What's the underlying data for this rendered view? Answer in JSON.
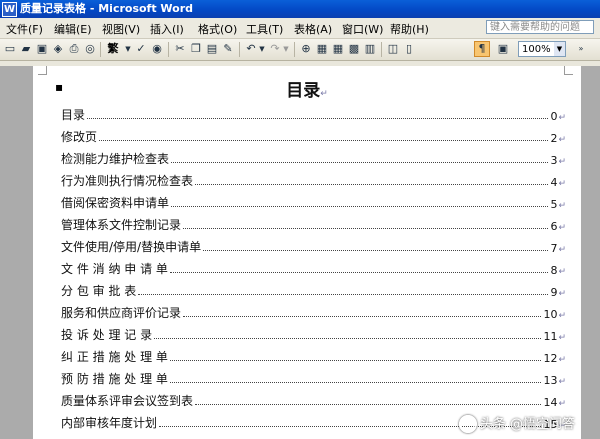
{
  "window": {
    "title": "质量记录表格 - Microsoft Word"
  },
  "menu": {
    "items": [
      "文件(F)",
      "编辑(E)",
      "视图(V)",
      "插入(I)",
      "格式(O)",
      "工具(T)",
      "表格(A)",
      "窗口(W)",
      "帮助(H)"
    ],
    "help_placeholder": "键入需要帮助的问题"
  },
  "toolbar": {
    "zoom": "100%",
    "font_style": "繁",
    "icons": [
      "new-doc-icon",
      "open-icon",
      "save-icon",
      "permission-icon",
      "print-icon",
      "print-preview-icon",
      "traditional-chinese-icon",
      "spelling-icon",
      "research-icon",
      "cut-icon",
      "copy-icon",
      "paste-icon",
      "format-painter-icon",
      "undo-icon",
      "redo-icon",
      "hyperlink-icon",
      "tables-borders-icon",
      "insert-table-icon",
      "insert-excel-icon",
      "columns-icon",
      "drawing-icon",
      "document-map-icon",
      "show-hide-icon",
      "read-icon"
    ]
  },
  "document": {
    "title": "目录",
    "toc": [
      {
        "label": "目录",
        "page": "0"
      },
      {
        "label": "修改页",
        "page": "2"
      },
      {
        "label": "检测能力维护检查表",
        "page": "3"
      },
      {
        "label": "行为准则执行情况检查表",
        "page": "4"
      },
      {
        "label": "借阅保密资料申请单",
        "page": "5"
      },
      {
        "label": "管理体系文件控制记录",
        "page": "6"
      },
      {
        "label": "文件使用/停用/替换申请单",
        "page": "7"
      },
      {
        "label": "文 件 消 纳 申 请 单",
        "page": "8"
      },
      {
        "label": "分  包  审  批  表",
        "page": "9"
      },
      {
        "label": "服务和供应商评价记录",
        "page": "10"
      },
      {
        "label": "投  诉  处  理  记  录",
        "page": "11"
      },
      {
        "label": "纠 正 措 施 处 理 单",
        "page": "12"
      },
      {
        "label": "预 防 措 施 处 理 单",
        "page": "13"
      },
      {
        "label": "质量体系评审会议签到表",
        "page": "14"
      },
      {
        "label": "内部审核年度计划",
        "page": "15"
      }
    ]
  },
  "watermark": {
    "text": "头条 @悟空问答"
  }
}
